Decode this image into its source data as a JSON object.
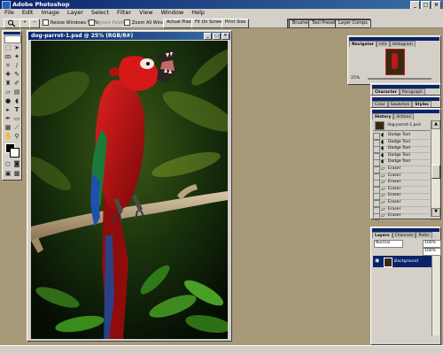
{
  "app": {
    "title": "Adobe Photoshop"
  },
  "window_controls": {
    "minimize": "_",
    "maximize": "□",
    "close": "×"
  },
  "menu": [
    "File",
    "Edit",
    "Image",
    "Layer",
    "Select",
    "Filter",
    "View",
    "Window",
    "Help"
  ],
  "options_bar": {
    "resize_windows_label": "Resize Windows To Fit",
    "ignore_palettes_label": "Ignore Palettes",
    "zoom_all_label": "Zoom All Windows",
    "actual_pixels": "Actual Pixels",
    "fit_on_screen": "Fit On Screen",
    "print_size": "Print Size",
    "tabs": [
      "Brushes",
      "Tool Presets",
      "Layer Comps"
    ]
  },
  "document": {
    "title": "dog-parrot-1.psd @ 25% (RGB/8#)"
  },
  "navigator": {
    "tabs": [
      "Navigator",
      "Info",
      "Histogram"
    ],
    "zoom": "25%"
  },
  "character": {
    "tabs": [
      "Character",
      "Paragraph"
    ]
  },
  "color": {
    "tabs": [
      "Color",
      "Swatches",
      "Styles"
    ]
  },
  "history": {
    "tabs": [
      "History",
      "Actions"
    ],
    "snapshot": "dog-parrot-1.psd",
    "items": [
      "Dodge Tool",
      "Dodge Tool",
      "Dodge Tool",
      "Dodge Tool",
      "Dodge Tool",
      "Eraser",
      "Eraser",
      "Eraser",
      "Eraser",
      "Eraser",
      "Eraser",
      "Eraser",
      "Eraser"
    ]
  },
  "layers": {
    "tabs": [
      "Layers",
      "Channels",
      "Paths"
    ],
    "blend_mode": "Normal",
    "opacity": "100%",
    "fill": "100%",
    "layer_name": "Background"
  },
  "colors": {
    "title_blue": "#0a246a",
    "workspace": "#a89a78",
    "ui_gray": "#d4d0c8",
    "parrot_red": "#c01818"
  }
}
